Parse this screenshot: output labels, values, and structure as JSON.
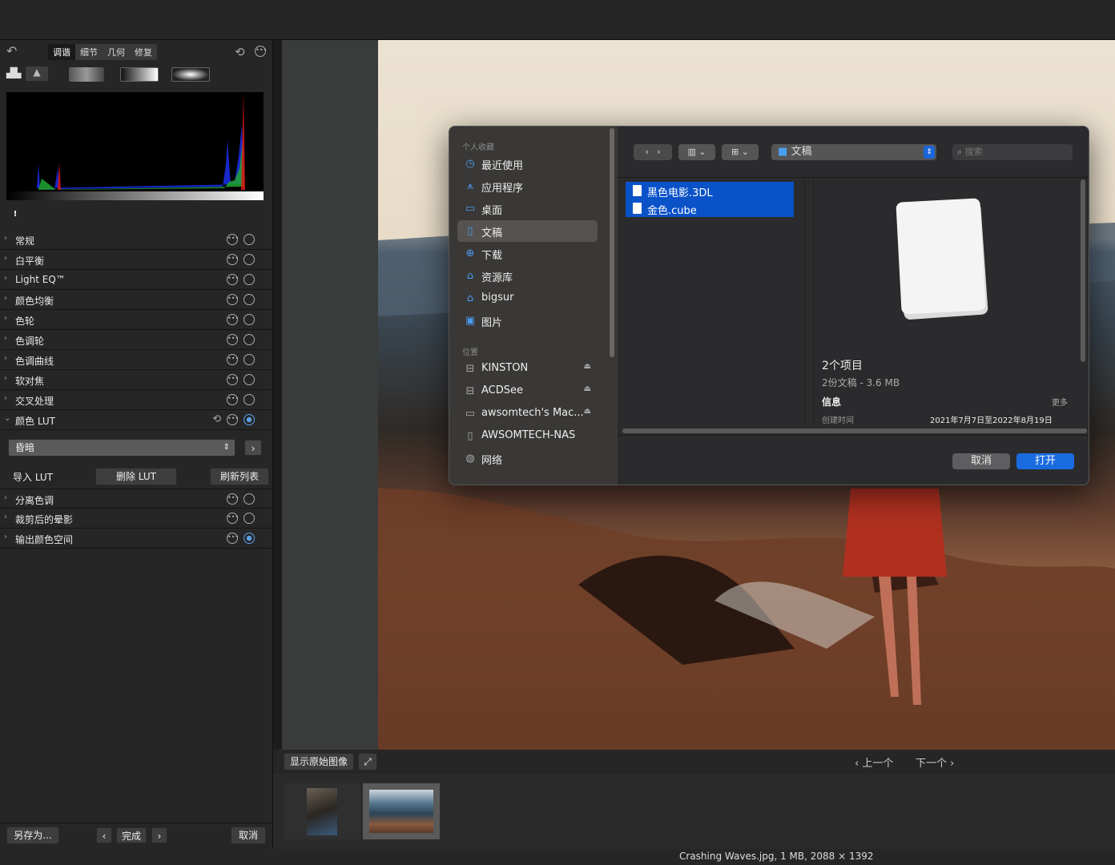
{
  "left": {
    "tabs": [
      "调谐",
      "细节",
      "几何",
      "修复"
    ],
    "sections": [
      "常规",
      "白平衡",
      "Light EQ™",
      "颜色均衡",
      "色轮",
      "色调轮",
      "色调曲线",
      "软对焦",
      "交叉处理",
      "颜色 LUT"
    ],
    "lut_select": "昏暗",
    "import_lut": "导入 LUT",
    "delete_lut": "删除 LUT",
    "refresh_list": "刷新列表",
    "sections2": [
      "分离色调",
      "裁剪后的晕影",
      "输出颜色空间"
    ],
    "save_as": "另存为...",
    "done": "完成",
    "cancel": "取消",
    "warn": "!"
  },
  "bottom": {
    "show_original": "显示原始图像",
    "prev": "上一个",
    "next": "下一个"
  },
  "status": "Crashing Waves.jpg, 1 MB, 2088 × 1392",
  "dialog": {
    "sidebar": {
      "fav_header": "个人收藏",
      "favorites": [
        {
          "label": "最近使用",
          "icon": "clock-icon"
        },
        {
          "label": "应用程序",
          "icon": "apps-icon"
        },
        {
          "label": "桌面",
          "icon": "desktop-icon"
        },
        {
          "label": "文稿",
          "icon": "document-icon"
        },
        {
          "label": "下载",
          "icon": "download-icon"
        },
        {
          "label": "资源库",
          "icon": "library-icon"
        },
        {
          "label": "bigsur",
          "icon": "home-icon"
        },
        {
          "label": "图片",
          "icon": "photos-icon"
        }
      ],
      "loc_header": "位置",
      "locations": [
        {
          "label": "KINSTON",
          "icon": "drive-icon"
        },
        {
          "label": "ACDSee",
          "icon": "drive-icon"
        },
        {
          "label": "awsomtech's Mac...",
          "icon": "computer-icon"
        },
        {
          "label": "AWSOMTECH-NAS",
          "icon": "server-icon"
        },
        {
          "label": "网络",
          "icon": "network-icon"
        }
      ]
    },
    "location": "文稿",
    "search_placeholder": "搜索",
    "files": [
      "黑色电影.3DL",
      "金色.cube"
    ],
    "preview": {
      "count": "2个项目",
      "kind": "2份文稿 - 3.6 MB",
      "info": "信息",
      "more": "更多",
      "created_label": "创建时间",
      "created_value": "2021年7月7日至2022年8月19日"
    },
    "cancel": "取消",
    "open": "打开"
  }
}
